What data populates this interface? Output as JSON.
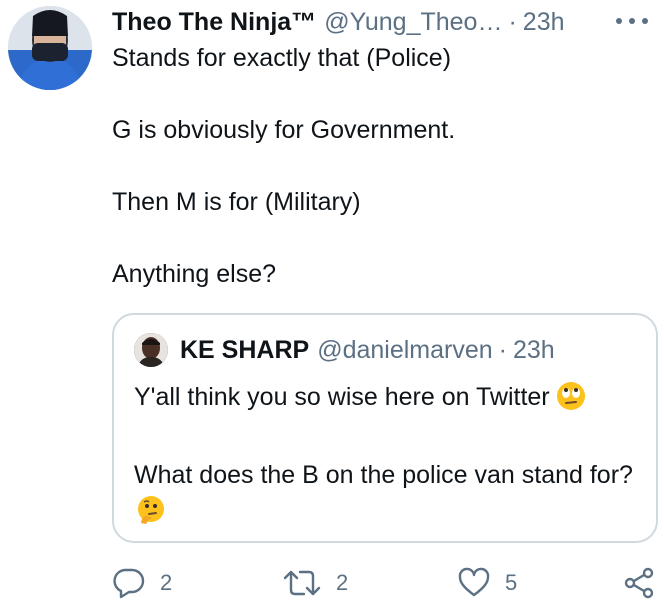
{
  "tweet": {
    "author_name": "Theo The Ninja™",
    "author_handle": "@Yung_Theo…",
    "separator": "·",
    "time": "23h",
    "lines": [
      "Stands for exactly that (Police)",
      "G is obviously for Government.",
      "Then M is for (Military)",
      "Anything else?"
    ]
  },
  "quoted": {
    "author_name": "KE SHARP",
    "author_handle": "@danielmarven",
    "separator": "·",
    "time": "23h",
    "line1": "Y'all think you so wise here on Twitter",
    "line2": "What does the B on the police van stand for?",
    "line1_emoji": "face-with-rolling-eyes",
    "line2_emoji": "thinking-face"
  },
  "actions": {
    "reply_count": "2",
    "retweet_count": "2",
    "like_count": "5"
  },
  "colors": {
    "text": "#0f1419",
    "secondary": "#5b7083",
    "border": "#cfd9de"
  }
}
